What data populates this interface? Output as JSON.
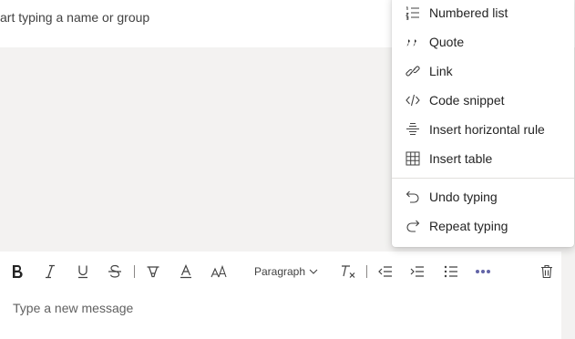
{
  "recipient": {
    "placeholder": "art typing a name or group"
  },
  "format_menu": {
    "items": [
      {
        "label": "Numbered list",
        "icon": "numbered-list-icon"
      },
      {
        "label": "Quote",
        "icon": "quote-icon"
      },
      {
        "label": "Link",
        "icon": "link-icon"
      },
      {
        "label": "Code snippet",
        "icon": "code-snippet-icon"
      },
      {
        "label": "Insert horizontal rule",
        "icon": "horizontal-rule-icon"
      },
      {
        "label": "Insert table",
        "icon": "table-icon"
      }
    ],
    "history": [
      {
        "label": "Undo typing",
        "icon": "undo-icon"
      },
      {
        "label": "Repeat typing",
        "icon": "redo-icon"
      }
    ]
  },
  "toolbar": {
    "paragraph_label": "Paragraph",
    "accent_color": "#6264a7"
  },
  "compose": {
    "placeholder": "Type a new message"
  }
}
